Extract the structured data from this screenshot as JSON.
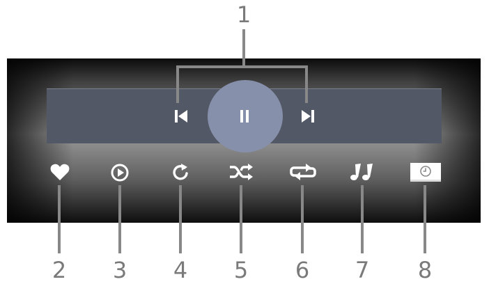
{
  "callouts": {
    "n1": "1",
    "n2": "2",
    "n3": "3",
    "n4": "4",
    "n5": "5",
    "n6": "6",
    "n7": "7",
    "n8": "8"
  },
  "icons": {
    "previous": "skip-previous-icon",
    "pause": "pause-icon",
    "next": "skip-next-icon",
    "favorite": "heart-icon",
    "play": "play-circle-icon",
    "rotate": "rotate-icon",
    "shuffle": "shuffle-icon",
    "repeat": "repeat-icon",
    "music": "music-notes-icon",
    "slideshow": "slideshow-timer-icon"
  },
  "colors": {
    "icon": "#ffffff",
    "player_bar": "#525866",
    "pause_circle": "#8790ab",
    "callout": "#7a7a7a"
  }
}
